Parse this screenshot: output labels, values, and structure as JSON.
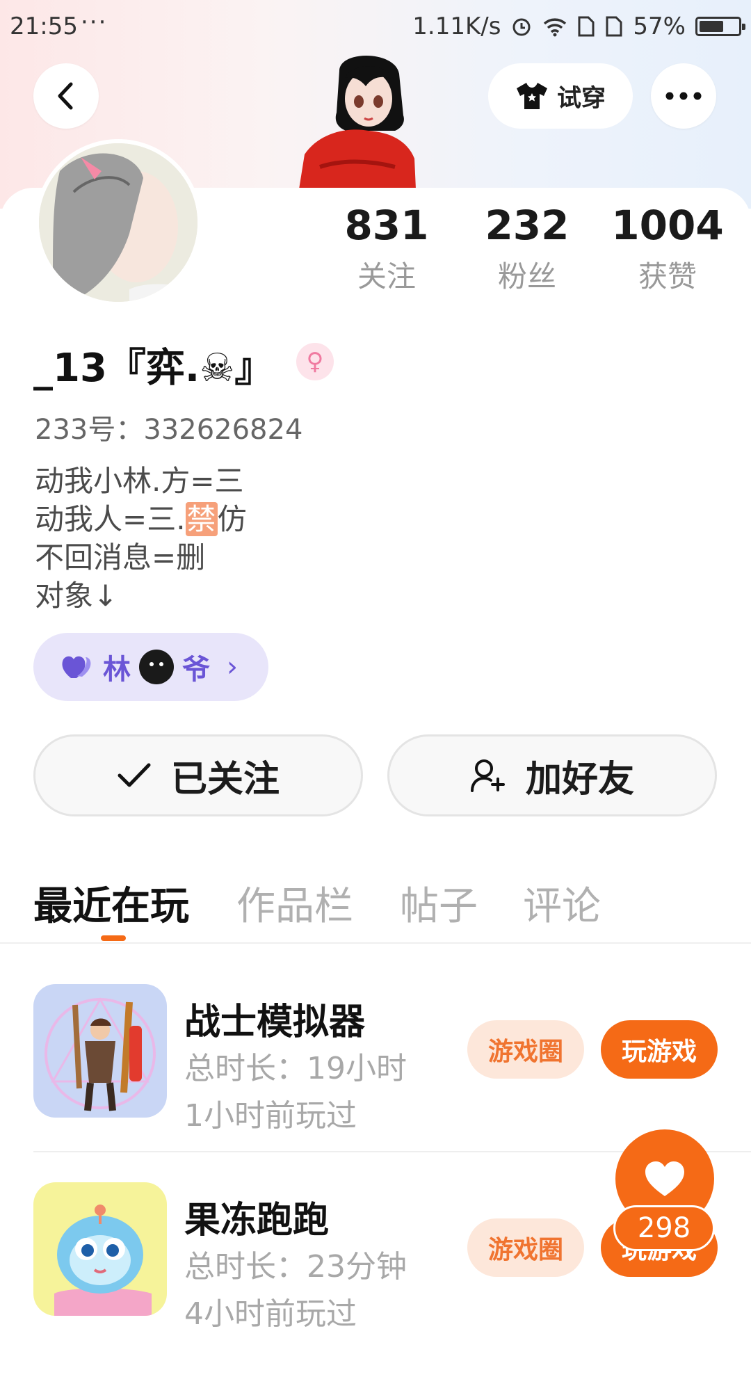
{
  "status_bar": {
    "time": "21:55",
    "more": "···",
    "network_speed": "1.11K/s",
    "battery_percent": "57%",
    "battery_level": 0.57
  },
  "header": {
    "tryon_label": "试穿"
  },
  "stats": [
    {
      "value": "831",
      "label": "关注"
    },
    {
      "value": "232",
      "label": "粉丝"
    },
    {
      "value": "1004",
      "label": "获赞"
    }
  ],
  "profile": {
    "username": "_13『弈.☠』",
    "gender_symbol": "♀",
    "account_id": "233号：332626824",
    "bio_line1": "动我小林.方=三",
    "bio_line2_a": "动我人=三.",
    "bio_ban": "禁",
    "bio_line2_b": "仿",
    "bio_line3": "不回消息=删",
    "bio_line4": "对象↓"
  },
  "partner": {
    "name_a": "林",
    "name_b": "爷",
    "chevron": "›"
  },
  "actions": {
    "followed_label": "已关注",
    "add_friend_label": "加好友"
  },
  "tabs": [
    "最近在玩",
    "作品栏",
    "帖子",
    "评论"
  ],
  "games": [
    {
      "name": "战士模拟器",
      "total_time": "总时长：19小时",
      "last_played": "1小时前玩过",
      "circle_label": "游戏圈",
      "play_label": "玩游戏"
    },
    {
      "name": "果冻跑跑",
      "total_time": "总时长：23分钟",
      "last_played": "4小时前玩过",
      "circle_label": "游戏圈",
      "play_label": "玩游戏"
    }
  ],
  "like": {
    "count": "298"
  },
  "colors": {
    "accent": "#f56a16",
    "partner_purple": "#6a55d6"
  }
}
